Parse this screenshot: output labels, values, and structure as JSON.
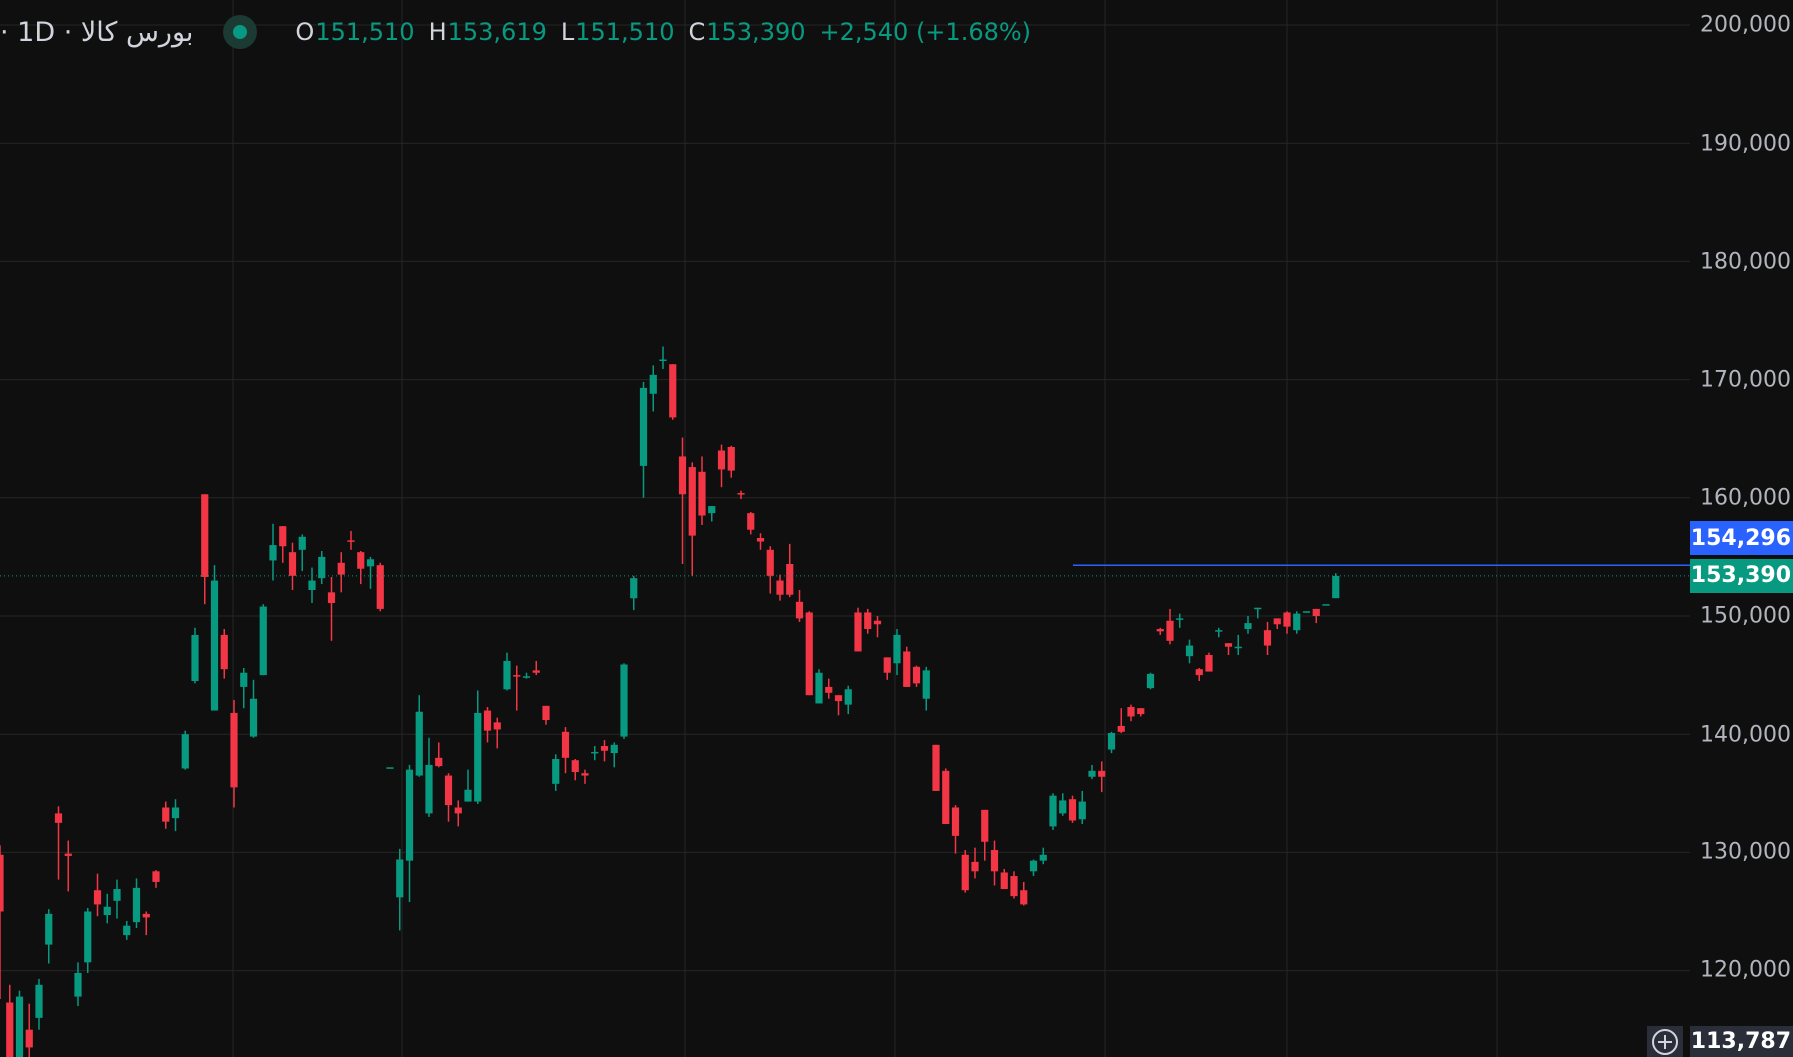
{
  "legend": {
    "symbol": "· 1D · بورس کالا",
    "open_label": "O",
    "open": "151,510",
    "high_label": "H",
    "high": "153,619",
    "low_label": "L",
    "low": "151,510",
    "close_label": "C",
    "close": "153,390",
    "change": "+2,540 (+1.68%)"
  },
  "price_axis": {
    "ticks": [
      "200,000",
      "190,000",
      "180,000",
      "170,000",
      "160,000",
      "150,000",
      "140,000",
      "130,000",
      "120,000"
    ]
  },
  "badges": {
    "horizontal_line_price": "154,296",
    "last_price": "153,390",
    "cursor_price": "113,787"
  },
  "colors": {
    "up": "#089981",
    "down": "#f23645",
    "background": "#0f0f0f",
    "grid": "#262626",
    "horizontal_line": "#2962ff"
  },
  "chart_data": {
    "type": "candlestick",
    "interval": "1D",
    "ylim": [
      113787,
      201500
    ],
    "horizontal_line": 154296,
    "last_price": 153390,
    "candles": [
      [
        129800,
        125000,
        130600,
        117600
      ],
      [
        117300,
        112000,
        118800,
        111000
      ],
      [
        112300,
        117800,
        118300,
        111000
      ],
      [
        115000,
        113500,
        117200,
        112000
      ],
      [
        116000,
        118800,
        119300,
        115000
      ],
      [
        122200,
        124800,
        125200,
        120600
      ],
      [
        133300,
        132500,
        133900,
        127700
      ],
      [
        129900,
        129700,
        131000,
        126700
      ],
      [
        117800,
        119800,
        120700,
        117000
      ],
      [
        120700,
        125000,
        125300,
        119800
      ],
      [
        126800,
        125600,
        128200,
        124600
      ],
      [
        124700,
        125400,
        126500,
        124000
      ],
      [
        125900,
        126900,
        127700,
        124400
      ],
      [
        123000,
        123800,
        124200,
        122600
      ],
      [
        124100,
        127000,
        127800,
        123600
      ],
      [
        124800,
        124500,
        125000,
        123000
      ],
      [
        128400,
        127500,
        128500,
        127000
      ],
      [
        133800,
        132600,
        134300,
        132000
      ],
      [
        132900,
        133800,
        134500,
        131800
      ],
      [
        137100,
        140000,
        140300,
        137000
      ],
      [
        144500,
        148400,
        149000,
        144300
      ],
      [
        160300,
        153300,
        160300,
        151000
      ],
      [
        142000,
        153000,
        154300,
        142000
      ],
      [
        148400,
        145500,
        148900,
        144700
      ],
      [
        141800,
        135500,
        142900,
        133800
      ],
      [
        144000,
        145200,
        145600,
        142200
      ],
      [
        139800,
        143000,
        144600,
        139700
      ],
      [
        145000,
        150800,
        151000,
        145000
      ],
      [
        154700,
        156000,
        157800,
        153000
      ],
      [
        157600,
        155900,
        157600,
        154500
      ],
      [
        155400,
        153400,
        156200,
        152200
      ],
      [
        155600,
        156700,
        156900,
        153800
      ],
      [
        152200,
        153000,
        154100,
        151100
      ],
      [
        153200,
        155000,
        155500,
        152700
      ],
      [
        152000,
        151100,
        153300,
        147900
      ],
      [
        154500,
        153500,
        155400,
        152000
      ],
      [
        156400,
        156300,
        157200,
        155600
      ],
      [
        155400,
        154000,
        155500,
        152700
      ],
      [
        154200,
        154800,
        155000,
        152300
      ],
      [
        154300,
        150600,
        154500,
        150400
      ],
      [
        137200,
        137200,
        137200,
        137200
      ],
      [
        126200,
        129400,
        130300,
        123400
      ],
      [
        129300,
        137000,
        137400,
        125800
      ],
      [
        136500,
        141900,
        143300,
        136400
      ],
      [
        133300,
        137400,
        139700,
        133000
      ],
      [
        138000,
        137300,
        139300,
        137200
      ],
      [
        136500,
        134000,
        136700,
        132600
      ],
      [
        133800,
        133300,
        134400,
        132200
      ],
      [
        134300,
        135300,
        137000,
        134300
      ],
      [
        134300,
        141800,
        143700,
        134100
      ],
      [
        142000,
        140300,
        142300,
        139300
      ],
      [
        141000,
        140400,
        141400,
        138800
      ],
      [
        143800,
        146200,
        146900,
        143700
      ],
      [
        145000,
        144900,
        145800,
        142000
      ],
      [
        144900,
        144900,
        145200,
        144700
      ],
      [
        145400,
        145200,
        146200,
        145000
      ],
      [
        142400,
        141200,
        142400,
        140800
      ],
      [
        135800,
        137900,
        138300,
        135200
      ],
      [
        140200,
        138000,
        140600,
        136700
      ],
      [
        137800,
        136800,
        137900,
        136100
      ],
      [
        136700,
        136500,
        137000,
        135800
      ],
      [
        138400,
        138500,
        139000,
        137800
      ],
      [
        139000,
        138600,
        139500,
        137700
      ],
      [
        138400,
        139100,
        139300,
        137200
      ],
      [
        139800,
        145900,
        146000,
        139600
      ],
      [
        151500,
        153200,
        153400,
        150500
      ],
      [
        162700,
        169300,
        169800,
        160000
      ],
      [
        168800,
        170400,
        171200,
        167300
      ],
      [
        171600,
        171700,
        172800,
        170900
      ],
      [
        171300,
        166800,
        171300,
        166600
      ],
      [
        163500,
        160300,
        165100,
        154400
      ],
      [
        162600,
        156800,
        163000,
        153400
      ],
      [
        162200,
        158500,
        163500,
        157700
      ],
      [
        158700,
        159300,
        159300,
        158000
      ],
      [
        164000,
        162400,
        164500,
        160900
      ],
      [
        164300,
        162300,
        164400,
        161700
      ],
      [
        160400,
        160300,
        160600,
        159900
      ],
      [
        158700,
        157300,
        158800,
        156900
      ],
      [
        156600,
        156300,
        157000,
        155600
      ],
      [
        155600,
        153400,
        155900,
        151900
      ],
      [
        153000,
        151800,
        153500,
        151300
      ],
      [
        154400,
        151800,
        156100,
        151600
      ],
      [
        151200,
        149800,
        152200,
        149500
      ],
      [
        150300,
        143300,
        150400,
        143300
      ],
      [
        142600,
        145200,
        145500,
        142600
      ],
      [
        144000,
        143500,
        144700,
        143000
      ],
      [
        143300,
        142800,
        143300,
        141600
      ],
      [
        142500,
        143800,
        144100,
        141700
      ],
      [
        150300,
        147000,
        150700,
        147000
      ],
      [
        150300,
        148900,
        150600,
        148500
      ],
      [
        149600,
        149300,
        150000,
        148200
      ],
      [
        146500,
        145200,
        146500,
        144600
      ],
      [
        146000,
        148400,
        148900,
        145000
      ],
      [
        147000,
        144000,
        147400,
        144000
      ],
      [
        145700,
        144300,
        145800,
        144000
      ],
      [
        143000,
        145400,
        145700,
        142000
      ],
      [
        139100,
        135200,
        139100,
        135200
      ],
      [
        136900,
        132400,
        137100,
        132400
      ],
      [
        133800,
        131400,
        134000,
        129900
      ],
      [
        129800,
        126800,
        130200,
        126600
      ],
      [
        129200,
        128400,
        130400,
        127800
      ],
      [
        133600,
        130900,
        133600,
        129300
      ],
      [
        130200,
        128400,
        131000,
        127200
      ],
      [
        128300,
        126900,
        128600,
        126900
      ],
      [
        128000,
        126300,
        128400,
        126100
      ],
      [
        126800,
        125600,
        127500,
        125500
      ],
      [
        128400,
        129300,
        129400,
        128000
      ],
      [
        129300,
        129800,
        130400,
        129000
      ],
      [
        132200,
        134800,
        135000,
        131900
      ],
      [
        133300,
        134400,
        135000,
        133100
      ],
      [
        134500,
        132700,
        134800,
        132500
      ],
      [
        132800,
        134300,
        135200,
        132400
      ],
      [
        136400,
        136900,
        137400,
        136200
      ],
      [
        136900,
        136400,
        137700,
        135100
      ],
      [
        138700,
        140100,
        140200,
        138400
      ],
      [
        140700,
        140200,
        142200,
        140100
      ],
      [
        142300,
        141500,
        142500,
        141100
      ],
      [
        142200,
        141700,
        142200,
        141500
      ],
      [
        143900,
        145100,
        145200,
        143800
      ],
      [
        148900,
        148700,
        149000,
        148400
      ],
      [
        149600,
        147900,
        150600,
        147600
      ],
      [
        149800,
        149800,
        150200,
        149000
      ],
      [
        146600,
        147500,
        148000,
        146000
      ],
      [
        145500,
        145000,
        145600,
        144500
      ],
      [
        146700,
        145300,
        146900,
        145300
      ],
      [
        148800,
        148800,
        149000,
        148200
      ],
      [
        147700,
        147400,
        147700,
        146700
      ],
      [
        147300,
        147400,
        148400,
        146700
      ],
      [
        148900,
        149400,
        150000,
        148500
      ],
      [
        150600,
        150700,
        150700,
        149800
      ],
      [
        148800,
        147500,
        149500,
        146700
      ],
      [
        149800,
        149300,
        149800,
        148900
      ],
      [
        150300,
        149100,
        150400,
        148500
      ],
      [
        148800,
        150200,
        150400,
        148500
      ],
      [
        150300,
        150400,
        150400,
        150300
      ],
      [
        150600,
        150000,
        150600,
        149400
      ],
      [
        151000,
        151000,
        151000,
        151000
      ],
      [
        151510,
        153390,
        153619,
        151510
      ]
    ]
  }
}
